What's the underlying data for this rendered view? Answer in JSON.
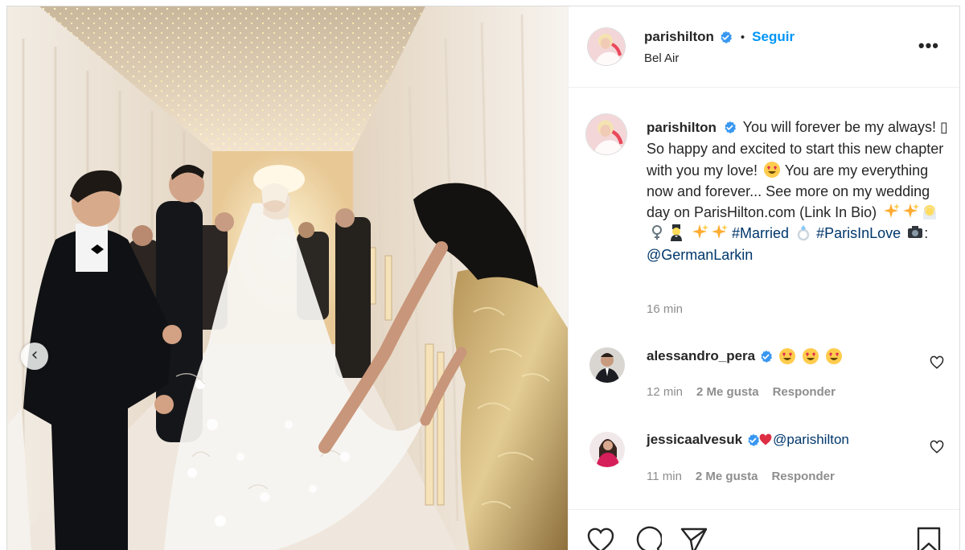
{
  "post": {
    "author": "parishilton",
    "follow_label": "Seguir",
    "separator": "•",
    "location": "Bel Air",
    "more_label": "•••"
  },
  "caption": {
    "author": "parishilton",
    "line1": "You will forever be my always! ▯ So happy and excited to start this new chapter with you my love! ",
    "line2": " You are my everything now and forever... See more on my wedding day on ParisHilton.com (Link In Bio)",
    "tag1": "#Married",
    "tag2": "#ParisInLove",
    "colon": ":",
    "mention": "@GermanLarkin",
    "time": "16 min"
  },
  "comments": [
    {
      "user": "alessandro_pera",
      "time": "12 min",
      "likes": "2 Me gusta",
      "reply": "Responder"
    },
    {
      "user": "jessicaalvesuk",
      "mention": "@parishilton",
      "time": "11 min",
      "likes": "2 Me gusta",
      "reply": "Responder"
    }
  ],
  "colors": {
    "accent": "#0095f6",
    "link": "#00376b",
    "muted": "#8e8e8e",
    "text": "#262626"
  },
  "icons": [
    "chevron-left-icon",
    "verified-badge-icon",
    "more-icon",
    "heart-icon",
    "comment-icon",
    "share-icon",
    "bookmark-icon",
    "heart-eyes-emoji"
  ]
}
